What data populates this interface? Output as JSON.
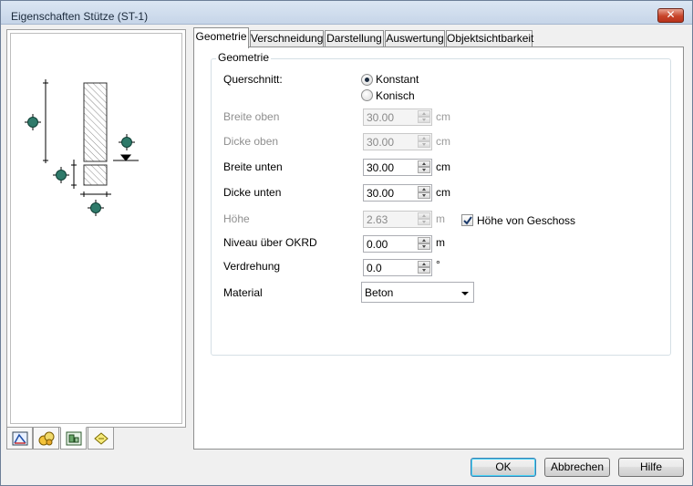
{
  "window": {
    "title": "Eigenschaften Stütze (ST-1)",
    "close_label": "✕"
  },
  "tabs": [
    {
      "label": "Geometrie",
      "active": true
    },
    {
      "label": "Verschneidung",
      "active": false
    },
    {
      "label": "Darstellung",
      "active": false
    },
    {
      "label": "Auswertung",
      "active": false
    },
    {
      "label": "Objektsichtbarkeit",
      "active": false
    }
  ],
  "geometry": {
    "group_title": "Geometrie",
    "querschnitt_label": "Querschnitt:",
    "radio_konstant": {
      "label": "Konstant",
      "selected": true
    },
    "radio_konisch": {
      "label": "Konisch",
      "selected": false
    },
    "fields": [
      {
        "label": "Breite oben",
        "value": "30.00",
        "unit": "cm",
        "enabled": false
      },
      {
        "label": "Dicke oben",
        "value": "30.00",
        "unit": "cm",
        "enabled": false
      },
      {
        "label": "Breite unten",
        "value": "30.00",
        "unit": "cm",
        "enabled": true
      },
      {
        "label": "Dicke unten",
        "value": "30.00",
        "unit": "cm",
        "enabled": true
      },
      {
        "label": "Höhe",
        "value": "2.63",
        "unit": "m",
        "enabled": false
      },
      {
        "label": "Niveau über OKRD",
        "value": "0.00",
        "unit": "m",
        "enabled": true
      },
      {
        "label": "Verdrehung",
        "value": "0.0",
        "unit": "°",
        "enabled": true
      }
    ],
    "hoehe_von_geschoss": {
      "label": "Höhe von Geschoss",
      "checked": true
    },
    "material": {
      "label": "Material",
      "value": "Beton"
    }
  },
  "mini_tabs": [
    {
      "icon": "geometry-icon"
    },
    {
      "icon": "material-icon"
    },
    {
      "icon": "display-icon"
    },
    {
      "icon": "report-icon"
    }
  ],
  "buttons": {
    "ok": "OK",
    "cancel": "Abbrechen",
    "help": "Hilfe"
  },
  "colors": {
    "marker_fill": "#2f7a6a",
    "default_button_border": "#3c7fb1"
  }
}
